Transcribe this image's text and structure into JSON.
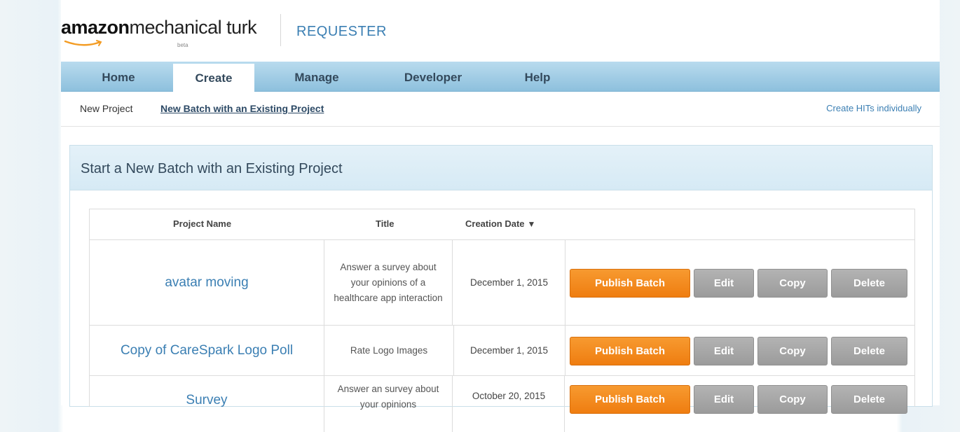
{
  "header": {
    "logo_amazon": "amazon",
    "logo_mt": "mechanical turk",
    "logo_beta": "beta",
    "requester": "REQUESTER"
  },
  "nav": {
    "tabs": [
      {
        "label": "Home",
        "active": false
      },
      {
        "label": "Create",
        "active": true
      },
      {
        "label": "Manage",
        "active": false
      },
      {
        "label": "Developer",
        "active": false
      },
      {
        "label": "Help",
        "active": false
      }
    ]
  },
  "subnav": {
    "new_project": "New Project",
    "new_batch": "New Batch with an Existing Project",
    "create_individually": "Create HITs individually"
  },
  "panel": {
    "title": "Start a New Batch with an Existing Project"
  },
  "table": {
    "headers": {
      "project_name": "Project Name",
      "title": "Title",
      "creation_date": "Creation Date",
      "sort_icon": "▼"
    },
    "buttons": {
      "publish": "Publish Batch",
      "edit": "Edit",
      "copy": "Copy",
      "delete": "Delete"
    },
    "rows": [
      {
        "name": "avatar moving",
        "title": "Answer a survey about your opinions of a healthcare app interaction",
        "date": "December 1, 2015"
      },
      {
        "name": "Copy of CareSpark Logo Poll",
        "title": "Rate Logo Images",
        "date": "December 1, 2015"
      },
      {
        "name": "Survey",
        "title": "Answer an survey about your opinions",
        "date": "October 20, 2015"
      }
    ]
  },
  "colors": {
    "nav_bg": "#9ccbe5",
    "publish_orange": "#f08a1c",
    "gray_button": "#a6a6a6",
    "link_blue": "#3b7fb3"
  }
}
